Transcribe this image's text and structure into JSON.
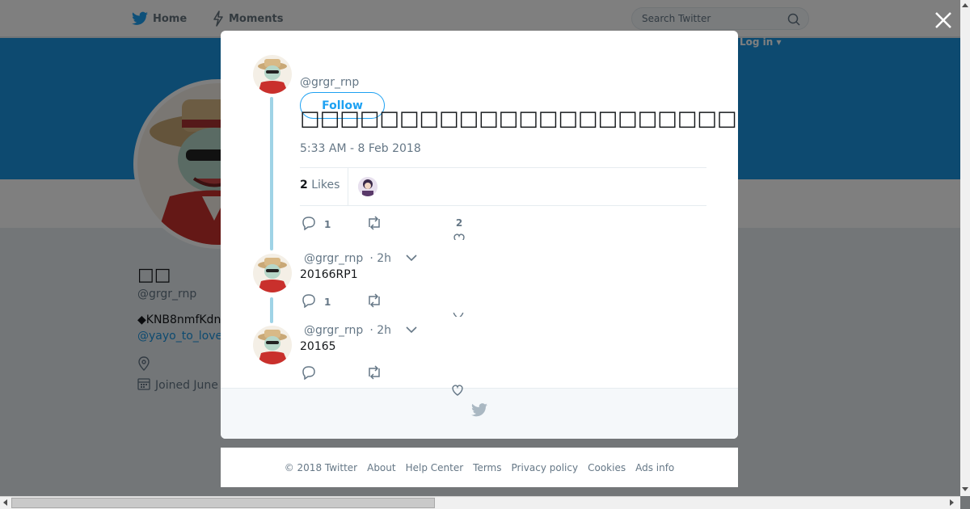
{
  "nav": {
    "home_label": "Home",
    "moments_label": "Moments",
    "search_placeholder": "Search Twitter",
    "login_label": "Log in ▾"
  },
  "profile": {
    "name": "□□",
    "handle": "@grgr_rnp",
    "bio": "◆KNB8nmfKdn",
    "link": "@yayo_to_love",
    "joined": "Joined June"
  },
  "tweet": {
    "handle": "@grgr_rnp",
    "follow_label": "Follow",
    "text": "□□□□□□□□□□□□□□□□□□□□□□□□□□□□□□□□□□□□□□GM□□PR□□□",
    "timestamp": "5:33 AM - 8 Feb 2018",
    "likes_count": "2",
    "likes_label": "Likes",
    "reply_count": "1",
    "like_count": "2"
  },
  "replies": [
    {
      "handle": "@grgr_rnp",
      "time": "· 2h",
      "text": "20166RP1",
      "reply_count": "1"
    },
    {
      "handle": "@grgr_rnp",
      "time": "· 2h",
      "text": "20165",
      "reply_count": ""
    }
  ],
  "footer": {
    "copyright": "© 2018 Twitter",
    "links": [
      "About",
      "Help Center",
      "Terms",
      "Privacy policy",
      "Cookies",
      "Ads info"
    ]
  },
  "colors": {
    "accent": "#1da1f2",
    "banner": "#1b95e0",
    "thread_line": "#9fd3e6"
  }
}
